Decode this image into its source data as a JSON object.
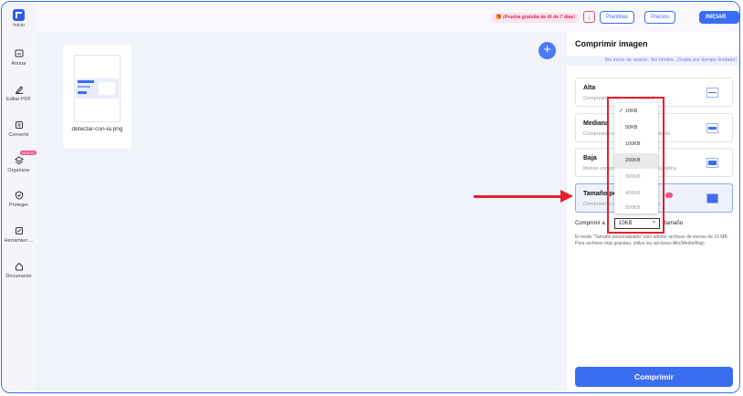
{
  "sidebar": {
    "items": [
      {
        "label": "Inicio",
        "icon": "home-logo-icon"
      },
      {
        "label": "Anotar",
        "icon": "annotate-icon"
      },
      {
        "label": "Editar PDF",
        "icon": "edit-icon"
      },
      {
        "label": "Convertir",
        "icon": "convert-icon"
      },
      {
        "label": "Organizar",
        "icon": "layers-icon",
        "badge": "NUEVO"
      },
      {
        "label": "Proteger",
        "icon": "shield-icon"
      },
      {
        "label": "Herramien ...",
        "icon": "tools-icon"
      },
      {
        "label": "Documento",
        "icon": "document-home-icon"
      }
    ]
  },
  "topbar": {
    "trial": "¡Prueba gratuita de IA de 7 días!",
    "templates": "Plantillas",
    "prices": "Precios",
    "login": "INICIAR SESIÓN"
  },
  "file": {
    "name": "detectar-con-ia.png"
  },
  "panel": {
    "title": "Comprimir imagen",
    "subtitle": "Sin inicio de sesión. Sin límites. ¡Gratis por tiempo limitado!",
    "options": [
      {
        "title": "Alta",
        "desc": "Compresión alta, menor calidad"
      },
      {
        "title": "Mediana",
        "desc": "Compresión media, calidad equilibrada"
      },
      {
        "title": "Baja",
        "desc": "Menos compresión, mayor calidad gráfica"
      },
      {
        "title": "Tamaño personalizado",
        "desc": "Comprimir a un tamaño específico"
      }
    ],
    "size_row_prefix": "Comprimir a",
    "size_row_suffix": "tamaño",
    "selected_size": "10KB",
    "note": "El modo \"Tamaño personalizado\" sólo admite archivos de menos de 10 MB. Para archivos más grandes, utilice las opciones Alto/Medio/Bajo",
    "compress_button": "Comprimir"
  },
  "size_menu": {
    "options": [
      "10KB",
      "50KB",
      "100KB",
      "200KB",
      "300KB",
      "400KB",
      "500KB"
    ],
    "checked": "10KB",
    "highlighted": "200KB"
  },
  "colors": {
    "accent": "#3b6df0",
    "annotation": "#e5202b"
  }
}
